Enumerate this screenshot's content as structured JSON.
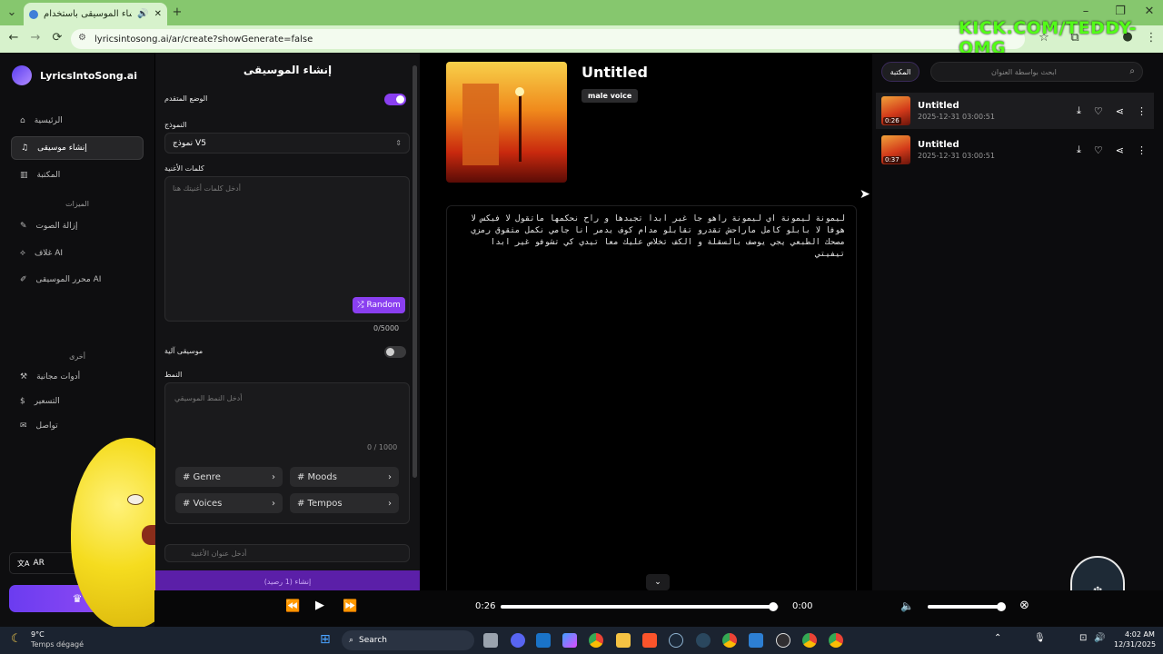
{
  "browser": {
    "tab_title": "إنشاء الموسيقى باستخدام AI",
    "url": "lyricsintosong.ai/ar/create?showGenerate=false"
  },
  "overlay_text": "KICK.COM/TEDDY-OMG",
  "sidebar": {
    "brand": "LyricsIntoSong.ai",
    "items": [
      {
        "label": "الرئيسية",
        "icon": "home-icon"
      },
      {
        "label": "إنشاء موسيقى",
        "icon": "music-icon"
      },
      {
        "label": "المكتبة",
        "icon": "library-icon"
      }
    ],
    "features_heading": "الميزات",
    "features": [
      {
        "label": "إزالة الصوت",
        "icon": "wand-icon"
      },
      {
        "label": "غلاف AI",
        "icon": "cover-icon"
      },
      {
        "label": "محرر الموسيقى AI",
        "icon": "edit-icon"
      }
    ],
    "other_heading": "أخرى",
    "others": [
      {
        "label": "أدوات مجانية",
        "icon": "tools-icon"
      },
      {
        "label": "التسعير",
        "icon": "dollar-icon"
      },
      {
        "label": "تواصل",
        "icon": "mail-icon"
      }
    ],
    "language": "AR"
  },
  "form": {
    "title": "إنشاء الموسيقى",
    "advanced_label": "الوضع المتقدم",
    "model_label": "النموذج",
    "model_value": "نموذج V5",
    "lyrics_label": "كلمات الأغنية",
    "lyrics_placeholder": "أدخل كلمات أغنيتك هنا",
    "random_button": "Random",
    "lyrics_count": "0/5000",
    "instrumental_label": "موسيقى آلية",
    "style_label": "النمط",
    "style_placeholder": "أدخل النمط الموسيقي",
    "style_count": "0 / 1000",
    "chips": [
      "# Genre",
      "# Moods",
      "# Voices",
      "# Tempos"
    ],
    "title_placeholder": "أدخل عنوان الأغنية",
    "create_button": "إنشاء (1 رصيد)"
  },
  "song": {
    "title": "Untitled",
    "tag": "male voice",
    "lyrics": "ليمونة ليمونة اي ليمونة راهو جا غير ابدا تجبدها و راح نحكمها ماتقول لا فيكس لا هوفا لا بابلو كامل ماراحش تقدرو تقابلو مدام كوف يدمر انا جامي نكمل مثقوق رمزي مصحك الطبعي يجي يوصف بالسقلة و الكف تخلاص عليك معا تيدي كي تشوفو غير ابدا تيفيتي"
  },
  "library": {
    "tab": "المكتبة",
    "search_placeholder": "ابحث بواسطة العنوان",
    "items": [
      {
        "title": "Untitled",
        "date": "2025-12-31 03:00:51",
        "duration": "0:26"
      },
      {
        "title": "Untitled",
        "date": "2025-12-31 03:00:51",
        "duration": "0:37"
      }
    ]
  },
  "player": {
    "current_time": "0:26",
    "end_time": "0:00",
    "progress": 0.98,
    "volume": 0.96
  },
  "taskbar": {
    "weather_temp": "9°C",
    "weather_desc": "Temps dégagé",
    "search": "Search",
    "time": "4:02 AM",
    "date": "12/31/2025"
  }
}
